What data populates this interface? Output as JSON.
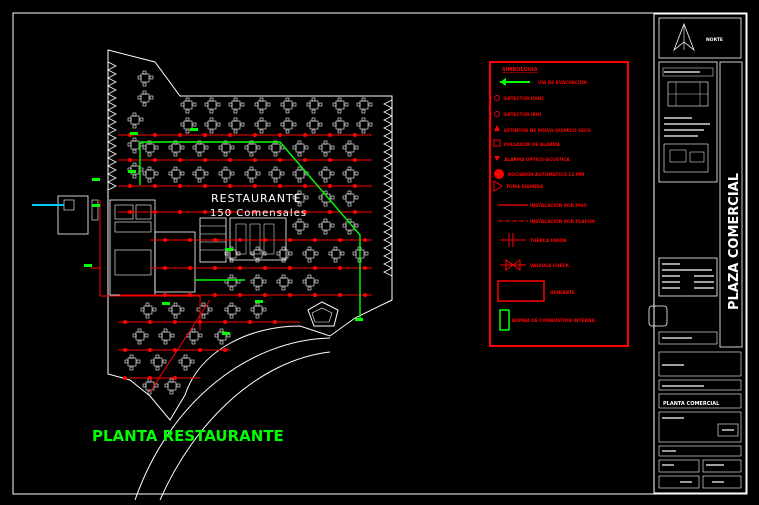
{
  "title": "PLANTA RESTAURANTE",
  "plan_label": {
    "name": "RESTAURANTE",
    "capacity": "150 Comensales"
  },
  "legend": {
    "heading": "SIMBOLOGIA",
    "items": [
      {
        "label": "VIA DE EVACUACION"
      },
      {
        "label": "DETECTOR IONIC"
      },
      {
        "label": "DETECTOR IRHI"
      },
      {
        "label": "EXTINTOR DE POLVO QUIMICO SECO"
      },
      {
        "label": "PULSADOR DE ALARMA"
      },
      {
        "label": "ALARMA OPTICO-ACUSTICA"
      },
      {
        "label": "ROCIADOR AUTOMATICO 12 MM"
      },
      {
        "label": "TOMA SIAMESA"
      },
      {
        "label": "INSTALACION POR PISO"
      },
      {
        "label": "INSTALACION POR PLAFON"
      },
      {
        "label": "TUERCA UNION"
      },
      {
        "label": "VALVULA CHECK"
      },
      {
        "label": "HIDRANTE"
      },
      {
        "label": "BOMBA DE COMBUSTION INTERNA"
      }
    ]
  },
  "title_block": {
    "north_label": "NORTE",
    "project": "PLAZA COMERCIAL",
    "sheet_title": "PLANTA COMERCIAL"
  },
  "colors": {
    "line": "#ffffff",
    "fire": "#ff0000",
    "evac": "#00ff00",
    "water": "#00ccff"
  }
}
